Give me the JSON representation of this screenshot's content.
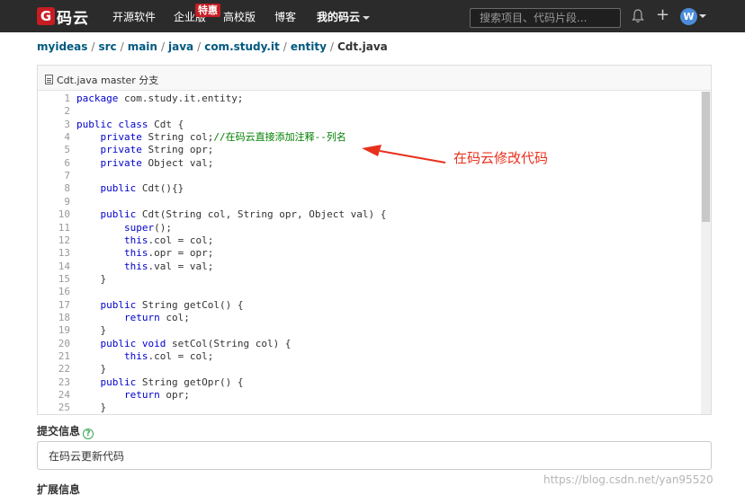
{
  "nav": {
    "logo_mark": "G",
    "logo_text": "码云",
    "items": [
      "开源软件",
      "企业版",
      "高校版",
      "博客",
      "我的码云"
    ],
    "badge": "特惠",
    "search_placeholder": "搜索项目、代码片段...",
    "avatar_letter": "W"
  },
  "breadcrumb": [
    "myideas",
    "src",
    "main",
    "java",
    "com.study.it",
    "entity",
    "Cdt.java"
  ],
  "file": {
    "header": "Cdt.java master 分支"
  },
  "code": [
    {
      "n": "1",
      "parts": [
        [
          "kw",
          "package"
        ],
        [
          "",
          " com.study.it.entity;"
        ]
      ]
    },
    {
      "n": "2",
      "parts": []
    },
    {
      "n": "3",
      "parts": [
        [
          "kw",
          "public class"
        ],
        [
          "",
          " Cdt {"
        ]
      ]
    },
    {
      "n": "4",
      "parts": [
        [
          "",
          "    "
        ],
        [
          "kw",
          "private"
        ],
        [
          "",
          " String col;"
        ],
        [
          "cm",
          "//在码云直接添加注释--列名"
        ]
      ]
    },
    {
      "n": "5",
      "parts": [
        [
          "",
          "    "
        ],
        [
          "kw",
          "private"
        ],
        [
          "",
          " String opr;"
        ]
      ]
    },
    {
      "n": "6",
      "parts": [
        [
          "",
          "    "
        ],
        [
          "kw",
          "private"
        ],
        [
          "",
          " Object val;"
        ]
      ]
    },
    {
      "n": "7",
      "parts": []
    },
    {
      "n": "8",
      "parts": [
        [
          "",
          "    "
        ],
        [
          "kw",
          "public"
        ],
        [
          "",
          " Cdt(){}"
        ]
      ]
    },
    {
      "n": "9",
      "parts": []
    },
    {
      "n": "10",
      "parts": [
        [
          "",
          "    "
        ],
        [
          "kw",
          "public"
        ],
        [
          "",
          " Cdt(String col, String opr, Object val) {"
        ]
      ]
    },
    {
      "n": "11",
      "parts": [
        [
          "",
          "        "
        ],
        [
          "kw",
          "super"
        ],
        [
          "",
          "();"
        ]
      ]
    },
    {
      "n": "12",
      "parts": [
        [
          "",
          "        "
        ],
        [
          "kw",
          "this"
        ],
        [
          "",
          ".col = col;"
        ]
      ]
    },
    {
      "n": "13",
      "parts": [
        [
          "",
          "        "
        ],
        [
          "kw",
          "this"
        ],
        [
          "",
          ".opr = opr;"
        ]
      ]
    },
    {
      "n": "14",
      "parts": [
        [
          "",
          "        "
        ],
        [
          "kw",
          "this"
        ],
        [
          "",
          ".val = val;"
        ]
      ]
    },
    {
      "n": "15",
      "parts": [
        [
          "",
          "    }"
        ]
      ]
    },
    {
      "n": "16",
      "parts": []
    },
    {
      "n": "17",
      "parts": [
        [
          "",
          "    "
        ],
        [
          "kw",
          "public"
        ],
        [
          "",
          " String getCol() {"
        ]
      ]
    },
    {
      "n": "18",
      "parts": [
        [
          "",
          "        "
        ],
        [
          "kw",
          "return"
        ],
        [
          "",
          " col;"
        ]
      ]
    },
    {
      "n": "19",
      "parts": [
        [
          "",
          "    }"
        ]
      ]
    },
    {
      "n": "20",
      "parts": [
        [
          "",
          "    "
        ],
        [
          "kw",
          "public void"
        ],
        [
          "",
          " setCol(String col) {"
        ]
      ]
    },
    {
      "n": "21",
      "parts": [
        [
          "",
          "        "
        ],
        [
          "kw",
          "this"
        ],
        [
          "",
          ".col = col;"
        ]
      ]
    },
    {
      "n": "22",
      "parts": [
        [
          "",
          "    }"
        ]
      ]
    },
    {
      "n": "23",
      "parts": [
        [
          "",
          "    "
        ],
        [
          "kw",
          "public"
        ],
        [
          "",
          " String getOpr() {"
        ]
      ]
    },
    {
      "n": "24",
      "parts": [
        [
          "",
          "        "
        ],
        [
          "kw",
          "return"
        ],
        [
          "",
          " opr;"
        ]
      ]
    },
    {
      "n": "25",
      "parts": [
        [
          "",
          "    }"
        ]
      ]
    }
  ],
  "annotation": "在码云修改代码",
  "commit": {
    "label": "提交信息",
    "help_icon": "?",
    "message": "在码云更新代码"
  },
  "extend_label": "扩展信息",
  "watermark": "https://blog.csdn.net/yan95520",
  "colors": {
    "accent": "#c71d23",
    "annotation": "#e8301c",
    "link": "#005980"
  }
}
